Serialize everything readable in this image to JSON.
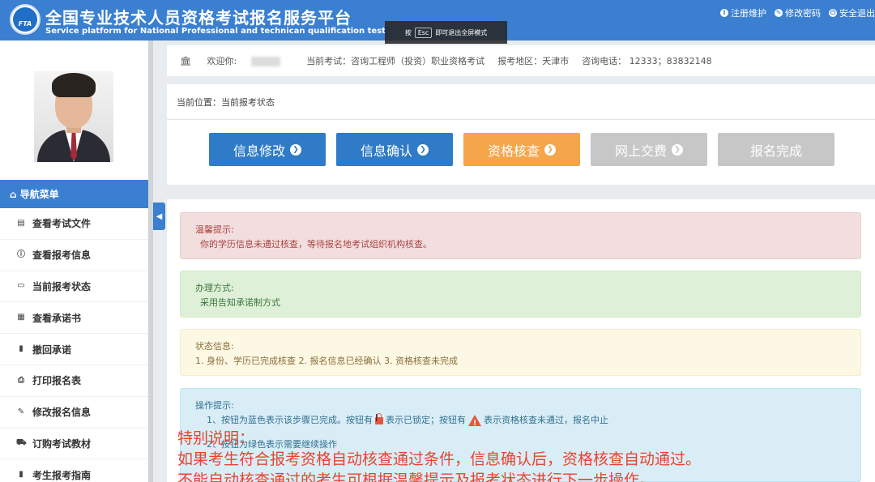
{
  "header": {
    "title": "全国专业技术人员资格考试报名服务平台",
    "subtitle": "Service platform for National Professional and technican qualification test",
    "logo_text": "FTA",
    "links": [
      "注册维护",
      "修改密码",
      "安全退出"
    ]
  },
  "esc_tip": {
    "prefix": "按",
    "key": "Esc",
    "suffix": "即可退出全屏模式"
  },
  "info_bar": {
    "welcome": "欢迎你:",
    "exam": "当前考试：咨询工程师（投资）职业资格考试",
    "region": "报考地区：天津市",
    "phone": "咨询电话： 12333；83832148"
  },
  "position": {
    "label": "当前位置：当前报考状态"
  },
  "steps": [
    {
      "label": "信息修改",
      "status": "done"
    },
    {
      "label": "信息确认",
      "status": "done"
    },
    {
      "label": "资格核查",
      "status": "current"
    },
    {
      "label": "网上交费",
      "status": "pending"
    },
    {
      "label": "报名完成",
      "status": "pending"
    }
  ],
  "sidebar": {
    "header": "导航菜单",
    "items": [
      {
        "label": "查看考试文件",
        "icon": "file-icon"
      },
      {
        "label": "查看报考信息",
        "icon": "info-icon"
      },
      {
        "label": "当前报考状态",
        "icon": "monitor-icon"
      },
      {
        "label": "查看承诺书",
        "icon": "card-icon"
      },
      {
        "label": "撤回承诺",
        "icon": "book-icon"
      },
      {
        "label": "打印报名表",
        "icon": "print-icon"
      },
      {
        "label": "修改报名信息",
        "icon": "edit-icon"
      },
      {
        "label": "订购考试教材",
        "icon": "cart-icon"
      },
      {
        "label": "考生报考指南",
        "icon": "book-icon"
      }
    ]
  },
  "alerts": {
    "tip": {
      "title": "温馨提示:",
      "body": "你的学历信息未通过核查，等待报名地考试组织机构核查。"
    },
    "method": {
      "title": "办理方式:",
      "body": "采用告知承诺制方式"
    },
    "status": {
      "title": "状态信息:",
      "body": "1. 身份、学历已完成核查 2. 报名信息已经确认 3. 资格核查未完成"
    },
    "ops": {
      "title": "操作提示:",
      "line1_a": "1、按钮为蓝色表示该步骤已完成。按钮有",
      "line1_b": "表示已锁定；按钮有",
      "line1_c": "表示资格核查未通过，报名中止",
      "line2": "2、按钮为绿色表示需要继续操作"
    }
  },
  "overlay": {
    "line1": "特别说明：",
    "line2": "如果考生符合报考资格自动核查通过条件，信息确认后，资格核查自动通过。",
    "line3": "不能自动核查通过的考生可根据温馨提示及报考状态进行下一步操作。"
  }
}
